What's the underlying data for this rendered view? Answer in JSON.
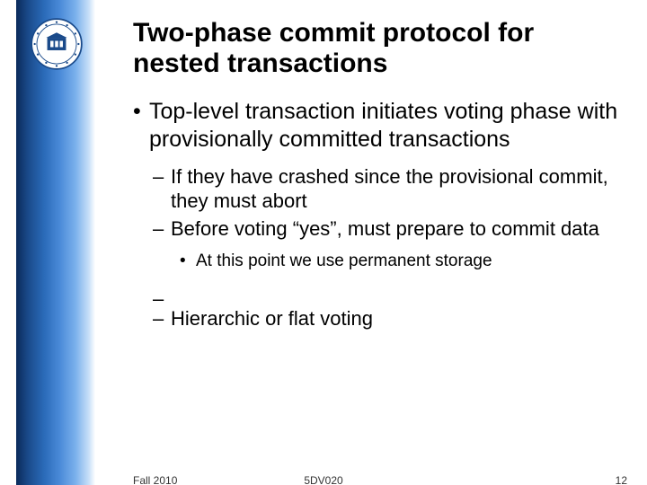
{
  "title": "Two-phase commit protocol for nested transactions",
  "bullets": {
    "l1_0": "Top-level transaction initiates voting phase with provisionally committed transactions",
    "l2_0": "If they have crashed since the provisional commit, they must abort",
    "l2_1": "Before voting “yes”, must prepare to commit data",
    "l3_0": "At this point we use permanent storage",
    "l2_2": "Hierarchic or flat voting"
  },
  "footer": {
    "left": "Fall 2010",
    "center": "5DV020",
    "right": "12"
  },
  "logo": {
    "name": "umea-university-seal-icon"
  }
}
